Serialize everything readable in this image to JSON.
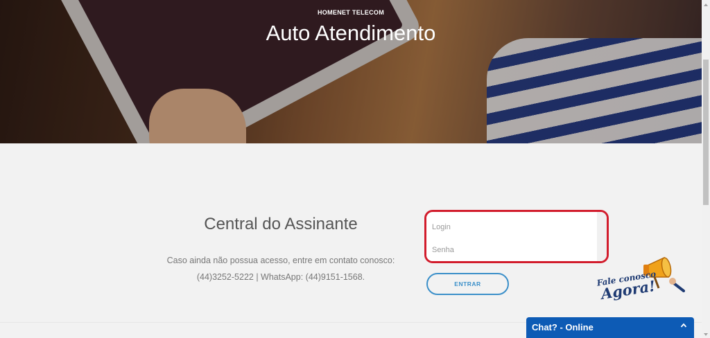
{
  "hero": {
    "brand": "HOMENET TELECOM",
    "title": "Auto Atendimento"
  },
  "section": {
    "title": "Central do Assinante",
    "text_line1": "Caso ainda não possua acesso, entre em contato conosco:",
    "text_line2": "(44)3252-5222 | WhatsApp: (44)9151-1568."
  },
  "form": {
    "login_placeholder": "Login",
    "password_placeholder": "Senha",
    "submit_label": "ENTRAR",
    "highlight_color": "#d21c2c",
    "button_color": "#3a8fc9"
  },
  "badge": {
    "line1": "Fale conosco",
    "line2": "Agora!",
    "icon": "megaphone-icon"
  },
  "chat": {
    "label": "Chat? - Online",
    "toggle_icon": "chevron-up-icon",
    "color": "#0d5bb5"
  }
}
